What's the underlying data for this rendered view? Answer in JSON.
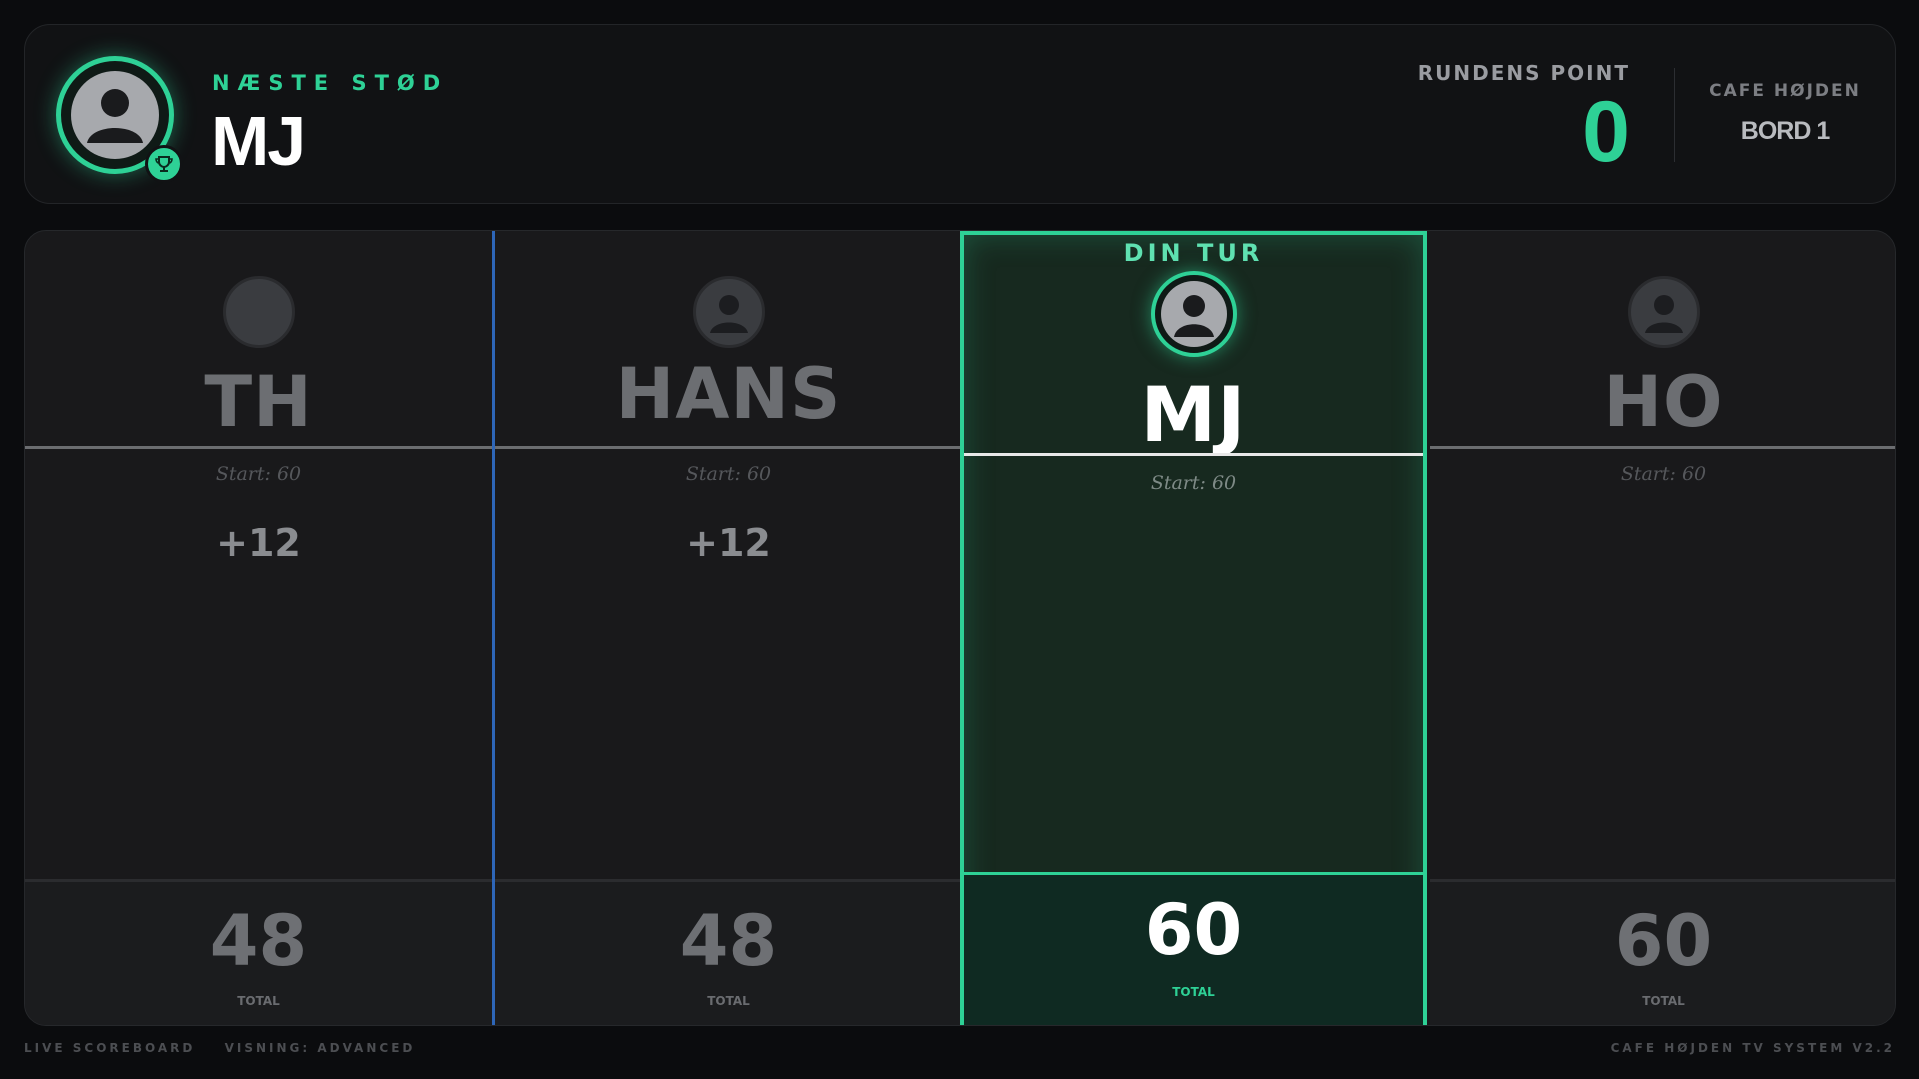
{
  "header": {
    "next_label": "NÆSTE STØD",
    "next_player": "MJ",
    "round_points_label": "RUNDENS POINT",
    "round_points_value": "0",
    "venue_label": "CAFE HØJDEN",
    "table_name": "BORD 1"
  },
  "board": {
    "active_label": "DIN TUR",
    "players": [
      {
        "name": "TH",
        "start": "Start: 60",
        "delta": "+12",
        "total": "48",
        "total_label": "TOTAL",
        "avatar": "photo"
      },
      {
        "name": "HANS",
        "start": "Start: 60",
        "delta": "+12",
        "total": "48",
        "total_label": "TOTAL",
        "avatar": "user-icon"
      },
      {
        "name": "MJ",
        "start": "Start: 60",
        "delta": "",
        "total": "60",
        "total_label": "TOTAL",
        "avatar": "user-icon",
        "active": true
      },
      {
        "name": "HO",
        "start": "Start: 60",
        "delta": "",
        "total": "60",
        "total_label": "TOTAL",
        "avatar": "user-icon"
      }
    ]
  },
  "footer": {
    "live": "LIVE SCOREBOARD",
    "view": "VISNING: ADVANCED",
    "system": "CAFE HØJDEN TV SYSTEM V2.2"
  },
  "colors": {
    "accent": "#2ed196",
    "separator": "#2e66b8",
    "background": "#0b0c0e"
  }
}
